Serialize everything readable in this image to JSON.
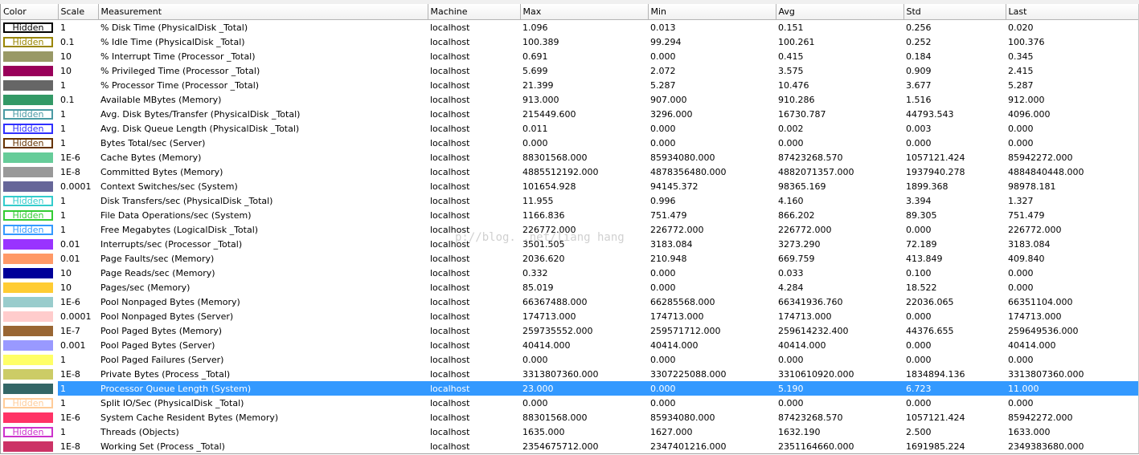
{
  "columns": [
    "Color",
    "Scale",
    "Measurement",
    "Machine",
    "Max",
    "Min",
    "Avg",
    "Std",
    "Last"
  ],
  "hidden_label": "Hidden",
  "watermark": "p://blog.      .net/liang      hang",
  "counters": [
    {
      "color": "#000000",
      "hidden": true,
      "scale": "1",
      "measurement": "% Disk Time (PhysicalDisk _Total)",
      "machine": "localhost",
      "max": "1.096",
      "min": "0.013",
      "avg": "0.151",
      "std": "0.256",
      "last": "0.020"
    },
    {
      "color": "#9a8600",
      "hidden": true,
      "scale": "0.1",
      "measurement": "% Idle Time (PhysicalDisk _Total)",
      "machine": "localhost",
      "max": "100.389",
      "min": "99.294",
      "avg": "100.261",
      "std": "0.252",
      "last": "100.376"
    },
    {
      "color": "#999966",
      "hidden": false,
      "scale": "10",
      "measurement": "% Interrupt Time (Processor _Total)",
      "machine": "localhost",
      "max": "0.691",
      "min": "0.000",
      "avg": "0.415",
      "std": "0.184",
      "last": "0.345"
    },
    {
      "color": "#99005a",
      "hidden": false,
      "scale": "10",
      "measurement": "% Privileged Time (Processor _Total)",
      "machine": "localhost",
      "max": "5.699",
      "min": "2.072",
      "avg": "3.575",
      "std": "0.909",
      "last": "2.415"
    },
    {
      "color": "#666666",
      "hidden": false,
      "scale": "1",
      "measurement": "% Processor Time (Processor _Total)",
      "machine": "localhost",
      "max": "21.399",
      "min": "5.287",
      "avg": "10.476",
      "std": "3.677",
      "last": "5.287"
    },
    {
      "color": "#339966",
      "hidden": false,
      "scale": "0.1",
      "measurement": "Available MBytes (Memory)",
      "machine": "localhost",
      "max": "913.000",
      "min": "907.000",
      "avg": "910.286",
      "std": "1.516",
      "last": "912.000"
    },
    {
      "color": "#4a9aa4",
      "hidden": true,
      "scale": "1",
      "measurement": "Avg. Disk Bytes/Transfer (PhysicalDisk _Total)",
      "machine": "localhost",
      "max": "215449.600",
      "min": "3296.000",
      "avg": "16730.787",
      "std": "44793.543",
      "last": "4096.000"
    },
    {
      "color": "#2f2fff",
      "hidden": true,
      "scale": "1",
      "measurement": "Avg. Disk Queue Length (PhysicalDisk _Total)",
      "machine": "localhost",
      "max": "0.011",
      "min": "0.000",
      "avg": "0.002",
      "std": "0.003",
      "last": "0.000"
    },
    {
      "color": "#663300",
      "hidden": true,
      "scale": "1",
      "measurement": "Bytes Total/sec (Server)",
      "machine": "localhost",
      "max": "0.000",
      "min": "0.000",
      "avg": "0.000",
      "std": "0.000",
      "last": "0.000"
    },
    {
      "color": "#66cc99",
      "hidden": false,
      "scale": "1E-6",
      "measurement": "Cache Bytes (Memory)",
      "machine": "localhost",
      "max": "88301568.000",
      "min": "85934080.000",
      "avg": "87423268.570",
      "std": "1057121.424",
      "last": "85942272.000"
    },
    {
      "color": "#999999",
      "hidden": false,
      "scale": "1E-8",
      "measurement": "Committed Bytes (Memory)",
      "machine": "localhost",
      "max": "4885512192.000",
      "min": "4878356480.000",
      "avg": "4882071357.000",
      "std": "1937940.278",
      "last": "4884840448.000"
    },
    {
      "color": "#666699",
      "hidden": false,
      "scale": "0.0001",
      "measurement": "Context Switches/sec (System)",
      "machine": "localhost",
      "max": "101654.928",
      "min": "94145.372",
      "avg": "98365.169",
      "std": "1899.368",
      "last": "98978.181"
    },
    {
      "color": "#33cccc",
      "hidden": true,
      "scale": "1",
      "measurement": "Disk Transfers/sec (PhysicalDisk _Total)",
      "machine": "localhost",
      "max": "11.955",
      "min": "0.996",
      "avg": "4.160",
      "std": "3.394",
      "last": "1.327"
    },
    {
      "color": "#33cc33",
      "hidden": true,
      "scale": "1",
      "measurement": "File Data Operations/sec (System)",
      "machine": "localhost",
      "max": "1166.836",
      "min": "751.479",
      "avg": "866.202",
      "std": "89.305",
      "last": "751.479"
    },
    {
      "color": "#3399ff",
      "hidden": true,
      "scale": "1",
      "measurement": "Free Megabytes (LogicalDisk _Total)",
      "machine": "localhost",
      "max": "226772.000",
      "min": "226772.000",
      "avg": "226772.000",
      "std": "0.000",
      "last": "226772.000"
    },
    {
      "color": "#9933ff",
      "hidden": false,
      "scale": "0.01",
      "measurement": "Interrupts/sec (Processor _Total)",
      "machine": "localhost",
      "max": "3501.505",
      "min": "3183.084",
      "avg": "3273.290",
      "std": "72.189",
      "last": "3183.084"
    },
    {
      "color": "#ff9966",
      "hidden": false,
      "scale": "0.01",
      "measurement": "Page Faults/sec (Memory)",
      "machine": "localhost",
      "max": "2036.620",
      "min": "210.948",
      "avg": "669.759",
      "std": "413.849",
      "last": "409.840"
    },
    {
      "color": "#000099",
      "hidden": false,
      "scale": "10",
      "measurement": "Page Reads/sec (Memory)",
      "machine": "localhost",
      "max": "0.332",
      "min": "0.000",
      "avg": "0.033",
      "std": "0.100",
      "last": "0.000"
    },
    {
      "color": "#ffcc33",
      "hidden": false,
      "scale": "10",
      "measurement": "Pages/sec (Memory)",
      "machine": "localhost",
      "max": "85.019",
      "min": "0.000",
      "avg": "4.284",
      "std": "18.522",
      "last": "0.000"
    },
    {
      "color": "#99cccc",
      "hidden": false,
      "scale": "1E-6",
      "measurement": "Pool Nonpaged Bytes (Memory)",
      "machine": "localhost",
      "max": "66367488.000",
      "min": "66285568.000",
      "avg": "66341936.760",
      "std": "22036.065",
      "last": "66351104.000"
    },
    {
      "color": "#ffcccc",
      "hidden": false,
      "scale": "0.0001",
      "measurement": "Pool Nonpaged Bytes (Server)",
      "machine": "localhost",
      "max": "174713.000",
      "min": "174713.000",
      "avg": "174713.000",
      "std": "0.000",
      "last": "174713.000"
    },
    {
      "color": "#996633",
      "hidden": false,
      "scale": "1E-7",
      "measurement": "Pool Paged Bytes (Memory)",
      "machine": "localhost",
      "max": "259735552.000",
      "min": "259571712.000",
      "avg": "259614232.400",
      "std": "44376.655",
      "last": "259649536.000"
    },
    {
      "color": "#9999ff",
      "hidden": false,
      "scale": "0.001",
      "measurement": "Pool Paged Bytes (Server)",
      "machine": "localhost",
      "max": "40414.000",
      "min": "40414.000",
      "avg": "40414.000",
      "std": "0.000",
      "last": "40414.000"
    },
    {
      "color": "#ffff66",
      "hidden": false,
      "scale": "1",
      "measurement": "Pool Paged Failures (Server)",
      "machine": "localhost",
      "max": "0.000",
      "min": "0.000",
      "avg": "0.000",
      "std": "0.000",
      "last": "0.000"
    },
    {
      "color": "#cccc66",
      "hidden": false,
      "scale": "1E-8",
      "measurement": "Private Bytes (Process _Total)",
      "machine": "localhost",
      "max": "3313807360.000",
      "min": "3307225088.000",
      "avg": "3310610920.000",
      "std": "1834894.136",
      "last": "3313807360.000"
    },
    {
      "color": "#336666",
      "hidden": false,
      "selected": true,
      "scale": "1",
      "measurement": "Processor Queue Length (System)",
      "machine": "localhost",
      "max": "23.000",
      "min": "0.000",
      "avg": "5.190",
      "std": "6.723",
      "last": "11.000"
    },
    {
      "color": "#ffcc99",
      "hidden": true,
      "scale": "1",
      "measurement": "Split IO/Sec (PhysicalDisk _Total)",
      "machine": "localhost",
      "max": "0.000",
      "min": "0.000",
      "avg": "0.000",
      "std": "0.000",
      "last": "0.000"
    },
    {
      "color": "#ff3366",
      "hidden": false,
      "scale": "1E-6",
      "measurement": "System Cache Resident Bytes (Memory)",
      "machine": "localhost",
      "max": "88301568.000",
      "min": "85934080.000",
      "avg": "87423268.570",
      "std": "1057121.424",
      "last": "85942272.000"
    },
    {
      "color": "#cc33cc",
      "hidden": true,
      "scale": "1",
      "measurement": "Threads (Objects)",
      "machine": "localhost",
      "max": "1635.000",
      "min": "1627.000",
      "avg": "1632.190",
      "std": "2.500",
      "last": "1633.000"
    },
    {
      "color": "#cc3366",
      "hidden": false,
      "scale": "1E-8",
      "measurement": "Working Set (Process _Total)",
      "machine": "localhost",
      "max": "2354675712.000",
      "min": "2347401216.000",
      "avg": "2351164660.000",
      "std": "1691985.224",
      "last": "2349383680.000"
    }
  ]
}
